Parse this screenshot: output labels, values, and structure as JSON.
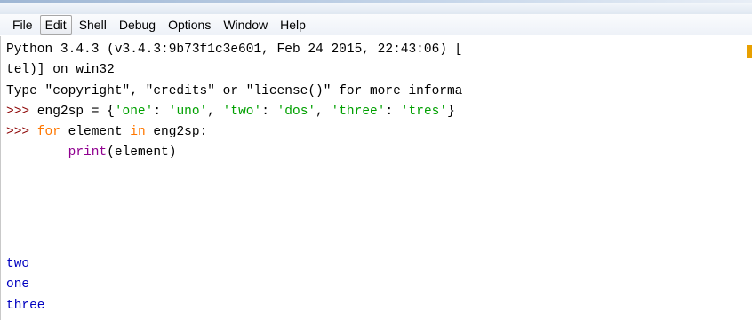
{
  "menu": {
    "items": [
      "File",
      "Edit",
      "Shell",
      "Debug",
      "Options",
      "Window",
      "Help"
    ],
    "active": "Edit"
  },
  "shell": {
    "banner_line1": "Python 3.4.3 (v3.4.3:9b73f1c3e601, Feb 24 2015, 22:43:06) [",
    "banner_line2": "tel)] on win32",
    "banner_line3": "Type \"copyright\", \"credits\" or \"license()\" for more informa",
    "prompt": ">>>",
    "cmd1": {
      "var": " eng2sp = {",
      "k1": "'one'",
      "sep1": ": ",
      "v1": "'uno'",
      "c1": ", ",
      "k2": "'two'",
      "sep2": ": ",
      "v2": "'dos'",
      "c2": ", ",
      "k3": "'three'",
      "sep3": ": ",
      "v3": "'tres'",
      "end": "}"
    },
    "cmd2": {
      "kw_for": "for",
      "mid": " element ",
      "kw_in": "in",
      "rest": " eng2sp:"
    },
    "cmd3": {
      "indent": "        ",
      "fn": "print",
      "args": "(element)"
    },
    "output": [
      "two",
      "one",
      "three"
    ]
  },
  "colors": {
    "prompt": "#8b0000",
    "keyword": "#ff7700",
    "string": "#00a000",
    "builtin": "#900090",
    "output": "#0000c0"
  }
}
